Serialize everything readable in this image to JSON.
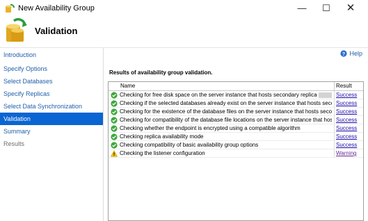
{
  "window": {
    "title": "New Availability Group",
    "minimize_glyph": "—",
    "maximize_glyph": "☐",
    "close_glyph": "✕"
  },
  "header": {
    "title": "Validation",
    "icon": "availability-group-icon"
  },
  "sidebar": {
    "items": [
      {
        "label": "Introduction",
        "state": "link"
      },
      {
        "label": "Specify Options",
        "state": "link"
      },
      {
        "label": "Select Databases",
        "state": "link"
      },
      {
        "label": "Specify Replicas",
        "state": "link"
      },
      {
        "label": "Select Data Synchronization",
        "state": "link"
      },
      {
        "label": "Validation",
        "state": "active"
      },
      {
        "label": "Summary",
        "state": "link"
      },
      {
        "label": "Results",
        "state": "disabled"
      }
    ]
  },
  "main": {
    "help_label": "Help",
    "results_heading": "Results of availability group validation.",
    "columns": {
      "name": "Name",
      "result": "Result"
    },
    "rows": [
      {
        "status": "success",
        "name": "Checking for free disk space on the server instance that hosts secondary replica",
        "result": "Success"
      },
      {
        "status": "success",
        "name": "Checking if the selected databases already exist on the server instance that hosts second...",
        "result": "Success"
      },
      {
        "status": "success",
        "name": "Checking for the existence of the database files on the server instance that hosts seconda...",
        "result": "Success"
      },
      {
        "status": "success",
        "name": "Checking for compatibility of the database file locations on the server instance that host...",
        "result": "Success"
      },
      {
        "status": "success",
        "name": "Checking whether the endpoint is encrypted using a compatible algorithm",
        "result": "Success"
      },
      {
        "status": "success",
        "name": "Checking replica availability mode",
        "result": "Success"
      },
      {
        "status": "success",
        "name": "Checking compatibility of basic availability group options",
        "result": "Success"
      },
      {
        "status": "warning",
        "name": "Checking the listener configuration",
        "result": "Warning"
      }
    ]
  },
  "colors": {
    "accent": "#0a64d2",
    "link": "#1f5fa8",
    "success": "#3ea83e",
    "warning": "#f2c200"
  }
}
